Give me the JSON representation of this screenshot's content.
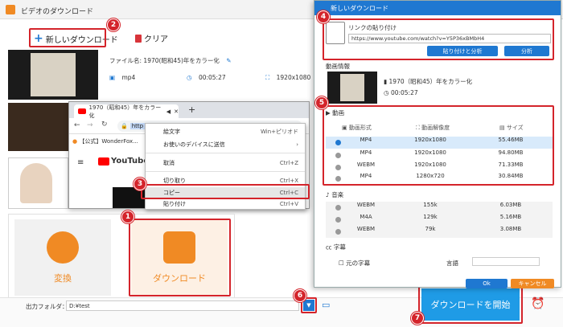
{
  "main": {
    "title": "ビデオのダウンロード",
    "new_download": "新しいダウンロード",
    "clear": "クリア",
    "item": {
      "file_label": "ファイル名: ",
      "file_name": "1970(昭和45)年をカラー化",
      "format": "mp4",
      "duration": "00:05:27",
      "resolution": "1920x1080"
    },
    "convert_label": "変換",
    "download_label": "ダウンロード",
    "output_folder_label": "出力フォルダ：",
    "output_folder_value": "D:¥test",
    "start_label": "ダウンロードを開始"
  },
  "browser": {
    "tab_title": "1970（昭和45）年をカラー化",
    "url": "http",
    "bookmark": "【公式】WonderFox...",
    "site": "YouTube"
  },
  "context_menu": {
    "items": [
      {
        "label": "絵文字",
        "shortcut": "Win+ピリオド"
      },
      {
        "label": "お使いのデバイスに送信",
        "shortcut": "›"
      },
      {
        "label": "取消",
        "shortcut": "Ctrl+Z"
      },
      {
        "label": "切り取り",
        "shortcut": "Ctrl+X"
      },
      {
        "label": "コピー",
        "shortcut": "Ctrl+C"
      },
      {
        "label": "貼り付け",
        "shortcut": "Ctrl+V"
      }
    ]
  },
  "dialog": {
    "title": "新しいダウンロード",
    "paste_link_label": "リンクの貼り付け",
    "url_value": "https://www.youtube.com/watch?v=Y5P36xBMbH4",
    "paste_analyze": "貼り付けと分析",
    "analyze": "分析",
    "video_info_label": "動画情報",
    "video_title": "1970（昭和45）年をカラー化",
    "video_duration": "00:05:27",
    "video_section": "動画",
    "video_headers": [
      "動画形式",
      "動画解像度",
      "サイズ"
    ],
    "video_rows": [
      {
        "format": "MP4",
        "res": "1920x1080",
        "size": "55.46MB",
        "selected": true
      },
      {
        "format": "MP4",
        "res": "1920x1080",
        "size": "94.80MB",
        "selected": false
      },
      {
        "format": "WEBM",
        "res": "1920x1080",
        "size": "71.33MB",
        "selected": false
      },
      {
        "format": "MP4",
        "res": "1280x720",
        "size": "30.84MB",
        "selected": false
      }
    ],
    "audio_section": "音楽",
    "audio_rows": [
      {
        "format": "WEBM",
        "bitrate": "155k",
        "size": "6.03MB"
      },
      {
        "format": "M4A",
        "bitrate": "129k",
        "size": "5.16MB"
      },
      {
        "format": "WEBM",
        "bitrate": "79k",
        "size": "3.08MB"
      }
    ],
    "subtitle_section": "字幕",
    "original_subtitle": "元の字幕",
    "language_label": "言語",
    "ok": "Ok",
    "cancel": "キャンセル"
  },
  "badges": [
    "1",
    "2",
    "3",
    "4",
    "5",
    "6",
    "7"
  ],
  "colors": {
    "accent_red": "#d4242b",
    "brand_orange": "#f08a24",
    "brand_blue": "#1f78d1"
  }
}
